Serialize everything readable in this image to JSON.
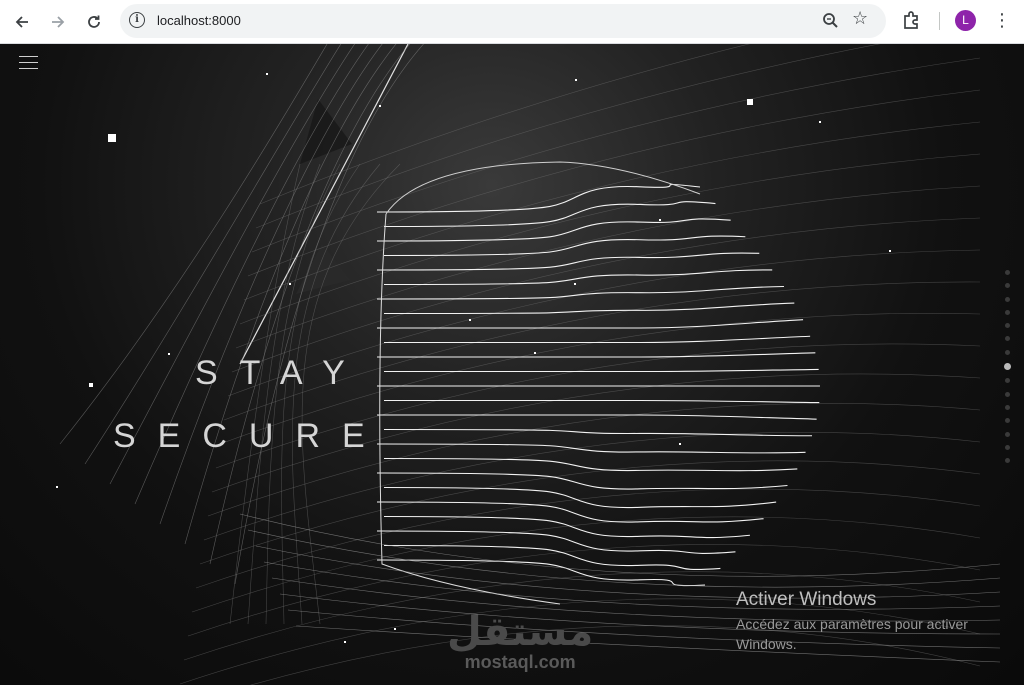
{
  "browser": {
    "url": "localhost:8000",
    "profile_initial": "L",
    "icons": {
      "back": "arrow-left-icon",
      "forward": "arrow-right-icon",
      "reload": "reload-icon",
      "info": "info-icon",
      "zoom": "zoom-icon",
      "bookmark": "star-icon",
      "extensions": "puzzle-icon",
      "menu": "kebab-menu-icon"
    },
    "accent": "#8e24aa"
  },
  "page": {
    "title_line1": "STAY",
    "title_line2": "SECURE",
    "nav_dot_count": 15,
    "active_dot_index": 7
  },
  "watermark": {
    "title": "Activer Windows",
    "text": "Accédez aux paramètres pour activer Windows."
  },
  "brand": {
    "arabic": "مستقل",
    "latin": "mostaql.com"
  }
}
